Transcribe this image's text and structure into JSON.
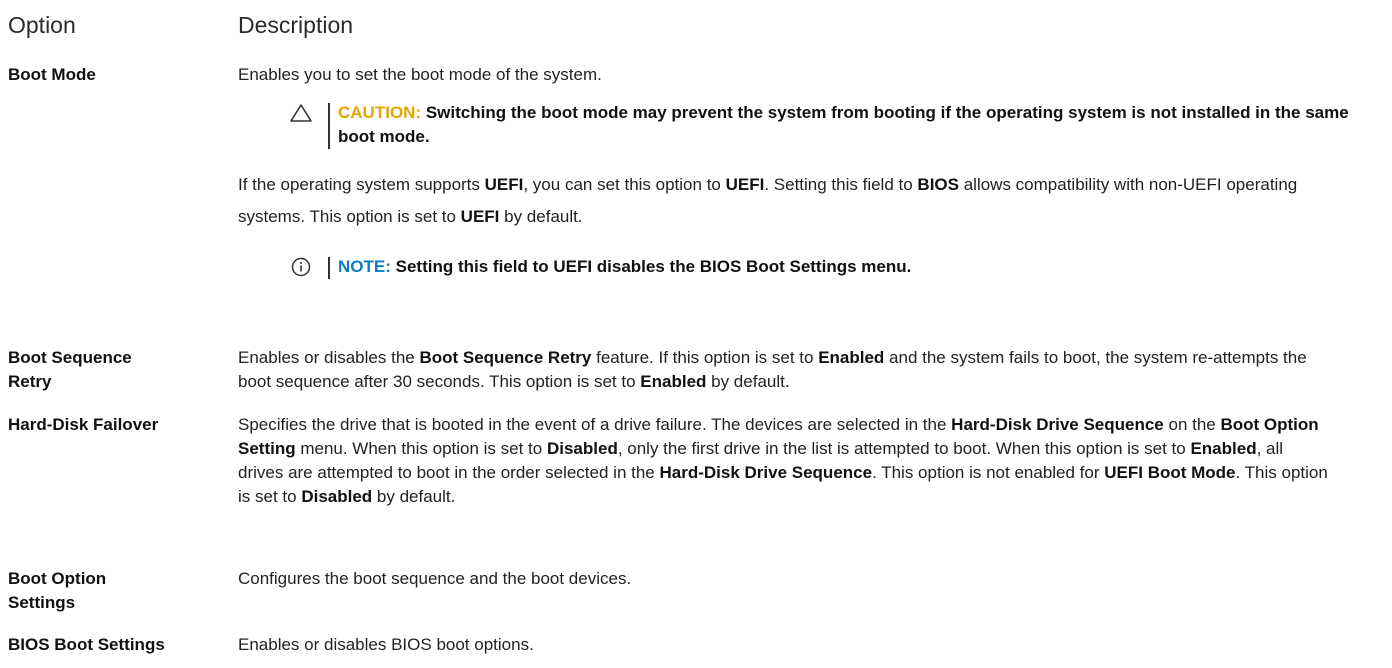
{
  "header": {
    "option": "Option",
    "description": "Description"
  },
  "boot_mode": {
    "option": "Boot Mode",
    "intro": "Enables you to set the boot mode of the system.",
    "caution": {
      "label": "CAUTION:",
      "text": "Switching the boot mode may prevent the system from booting if the operating system is not installed in the same boot mode."
    },
    "body": {
      "t1": "If the operating system supports ",
      "b1": "UEFI",
      "t2": ", you can set this option to ",
      "b2": "UEFI",
      "t3": ". Setting this field to ",
      "b3": "BIOS",
      "t4": " allows compatibility with non-UEFI operating systems. This option is set to ",
      "b4": "UEFI",
      "t5": " by default."
    },
    "note": {
      "label": "NOTE:",
      "text": "Setting this field to UEFI disables the BIOS Boot Settings menu."
    }
  },
  "boot_sequence_retry": {
    "option_line1": "Boot Sequence",
    "option_line2": "Retry",
    "t1": "Enables or disables the ",
    "b1": "Boot Sequence Retry",
    "t2": " feature. If this option is set to ",
    "b2": "Enabled",
    "t3": " and the system fails to boot, the system re-attempts the boot sequence after 30 seconds. This option is set to ",
    "b3": "Enabled",
    "t4": " by default."
  },
  "hard_disk_failover": {
    "option": "Hard-Disk Failover",
    "t1": "Specifies the drive that is booted in the event of a drive failure. The devices are selected in the ",
    "b1": "Hard-Disk Drive Sequence",
    "t2": " on the ",
    "b2": "Boot Option Setting",
    "t3": " menu. When this option is set to ",
    "b3": "Disabled",
    "t4": ", only the first drive in the list is attempted to boot. When this option is set to ",
    "b4": "Enabled",
    "t5": ", all drives are attempted to boot in the order selected in the ",
    "b5": "Hard-Disk Drive Sequence",
    "t6": ". This option is not enabled for ",
    "b6": "UEFI Boot Mode",
    "t7": ". This option is set to ",
    "b7": "Disabled",
    "t8": " by default."
  },
  "boot_option_settings": {
    "option_line1": "Boot Option",
    "option_line2": "Settings",
    "desc": "Configures the boot sequence and the boot devices."
  },
  "bios_boot_settings": {
    "option": "BIOS Boot Settings",
    "desc": "Enables or disables BIOS boot options."
  },
  "colors": {
    "caution": "#e8a400",
    "note": "#0a7ec2"
  },
  "icons": {
    "caution": "warning-triangle-icon",
    "note": "info-circle-icon"
  }
}
